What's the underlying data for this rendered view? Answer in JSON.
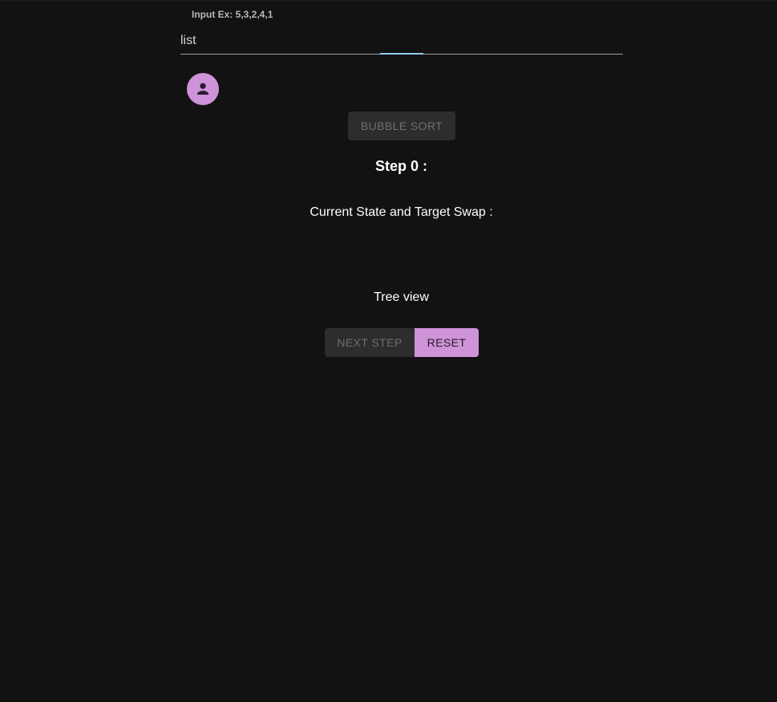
{
  "input": {
    "hint": "Input Ex: 5,3,2,4,1",
    "placeholder": "list",
    "value": ""
  },
  "avatar": {
    "icon": "person-icon",
    "color": "#ce93d8"
  },
  "sort_button": {
    "label": "BUBBLE SORT",
    "disabled": true
  },
  "step": {
    "title": "Step 0 :"
  },
  "current_state": {
    "label": "Current State and Target Swap :"
  },
  "tree": {
    "label": "Tree view"
  },
  "controls": {
    "next_label": "NEXT STEP",
    "next_disabled": true,
    "reset_label": "RESET"
  },
  "colors": {
    "background": "#121212",
    "accent": "#ce93d8",
    "focus": "#90caf9"
  }
}
